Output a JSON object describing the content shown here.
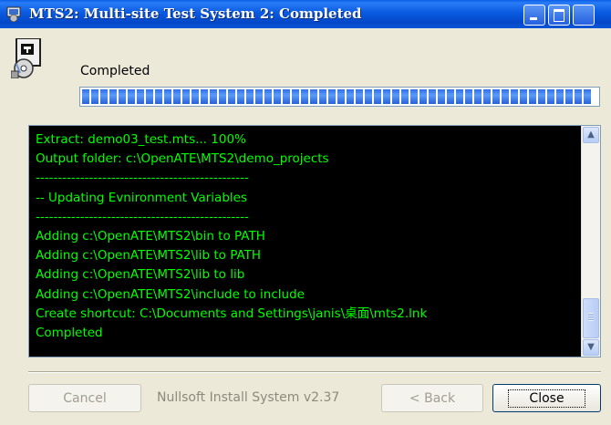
{
  "window": {
    "title": "MTS2: Multi-site Test System 2: Completed",
    "controls": {
      "minimize": "minimize",
      "maximize": "maximize",
      "close": "close"
    }
  },
  "header": {
    "status": "Completed",
    "progress_percent": 100,
    "icon": "installer-cd-icon"
  },
  "log": {
    "lines": [
      "Extract: demo03_test.mts... 100%",
      "Output folder: c:\\OpenATE\\MTS2\\demo_projects",
      "------------------------------------------------",
      "-- Updating Evnironment Variables",
      "------------------------------------------------",
      "Adding c:\\OpenATE\\MTS2\\bin to PATH",
      "Adding c:\\OpenATE\\MTS2\\lib to PATH",
      "Adding c:\\OpenATE\\MTS2\\lib to lib",
      "Adding c:\\OpenATE\\MTS2\\include to include",
      "Create shortcut: C:\\Documents and Settings\\janis\\桌面\\mts2.lnk",
      "Completed"
    ],
    "text_color": "#00ff00",
    "background": "#000000"
  },
  "footer": {
    "cancel_label": "Cancel",
    "branding": "Nullsoft Install System v2.37",
    "back_label": "< Back",
    "close_label": "Close"
  },
  "colors": {
    "titlebar": "#0a5ae0",
    "progress_fill": "#2f6fe8",
    "dialog_bg": "#ece9d8"
  }
}
